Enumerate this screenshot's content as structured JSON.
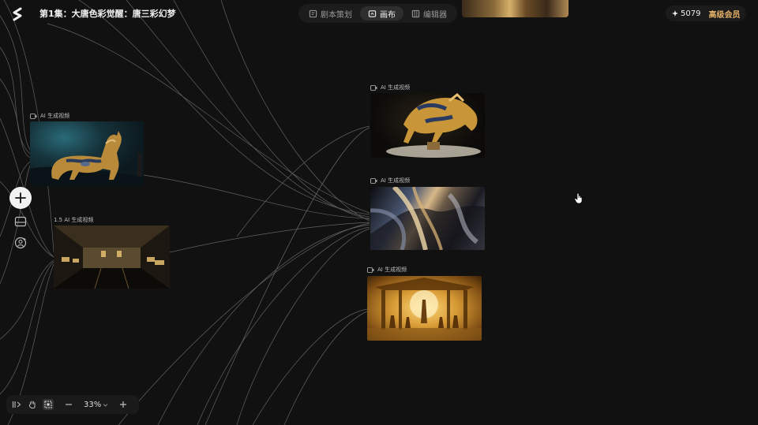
{
  "header": {
    "title": "第1集：大唐色彩觉醒：唐三彩幻梦",
    "tabs": [
      {
        "label": "剧本策划",
        "icon": "script-icon",
        "active": false
      },
      {
        "label": "画布",
        "icon": "canvas-icon",
        "active": true
      },
      {
        "label": "编辑器",
        "icon": "editor-icon",
        "active": false
      }
    ],
    "credits": "5079",
    "vip_label": "高级会员"
  },
  "canvas": {
    "zoom": "33%",
    "nodes": [
      {
        "label": "AI 生成视频",
        "image": "tang-sancai-horse-teal-spotlight"
      },
      {
        "label": "1.5 AI 生成视频",
        "image": "museum-hall-display"
      },
      {
        "label": "AI 生成视频",
        "image": "tang-sancai-horse-rearing"
      },
      {
        "label": "AI 生成视频",
        "image": "golden-smoke-swirl"
      },
      {
        "label": "AI 生成视频",
        "image": "golden-temple-dancers"
      }
    ]
  },
  "colors": {
    "background": "#111111",
    "accent_gold": "#e7b36a",
    "edge": "#8a8a8a"
  }
}
